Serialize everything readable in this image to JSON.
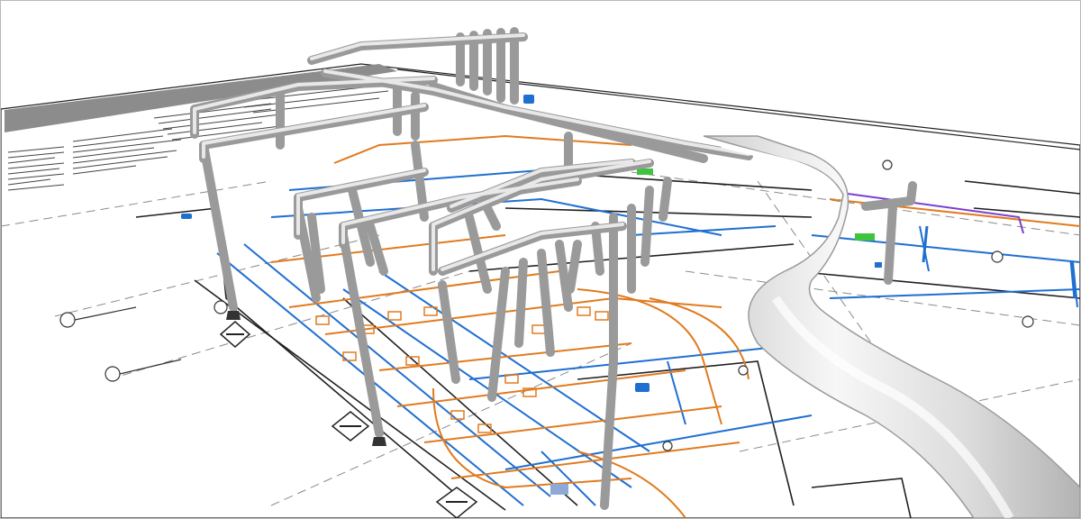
{
  "scene": {
    "colors": {
      "background": "#ffffff",
      "sheet_edge": "#222222",
      "title_bar": "#8c8c8c",
      "blue_lines": "#1f6fd1",
      "orange_lines": "#e07b1f",
      "dark_lines": "#202020",
      "gray_lines": "#7a7a7a",
      "pipe_fill": "#c9c9c9",
      "pipe_highlight": "#f2f2f2",
      "accent_green": "#3ec43e",
      "accent_purple": "#7a3fd1"
    },
    "icons": [
      "tag-marker-icon",
      "section-marker-icon",
      "equipment-symbol-icon"
    ]
  }
}
